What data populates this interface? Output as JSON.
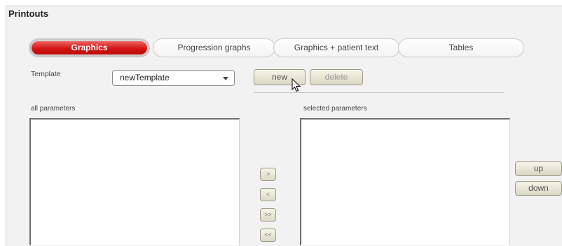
{
  "window": {
    "title": "Printouts"
  },
  "tabs": [
    {
      "label": "Graphics",
      "active": true
    },
    {
      "label": "Progression graphs",
      "active": false
    },
    {
      "label": "Graphics + patient text",
      "active": false
    },
    {
      "label": "Tables",
      "active": false
    }
  ],
  "template": {
    "label": "Template",
    "selected_value": "newTemplate",
    "new_label": "new",
    "delete_label": "delete"
  },
  "lists": {
    "all_label": "all parameters",
    "selected_label": "selected parameters"
  },
  "transfer": {
    "add_one": ">",
    "remove_one": "<",
    "add_all": ">>",
    "remove_all": "<<"
  },
  "ordering": {
    "up_label": "up",
    "down_label": "down"
  },
  "colors": {
    "active_tab": "#d31414",
    "button_face": "#e9e8d6"
  }
}
